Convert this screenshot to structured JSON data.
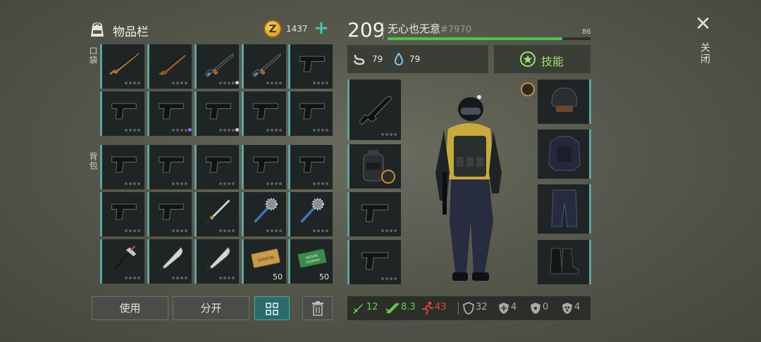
{
  "inventory": {
    "title": "物品栏",
    "coins": "1437",
    "coin_symbol": "Z",
    "add_symbol": "+",
    "pocket_label": "口袋",
    "backpack_label": "背包",
    "pocket_items": [
      {
        "icon": "sniper-rifle-icon",
        "marker": ""
      },
      {
        "icon": "shotgun-icon",
        "marker": ""
      },
      {
        "icon": "ak-rifle-icon",
        "marker": "#cfcfcf"
      },
      {
        "icon": "ak-rifle-icon",
        "marker": ""
      },
      {
        "icon": "pistol-icon",
        "marker": ""
      },
      {
        "icon": "pistol-icon",
        "marker": ""
      },
      {
        "icon": "pistol-icon",
        "marker": "#9a6bff"
      },
      {
        "icon": "pistol-icon",
        "marker": "#cfcfcf"
      },
      {
        "icon": "pistol-icon",
        "marker": ""
      },
      {
        "icon": "pistol-icon",
        "marker": ""
      },
      {
        "icon": "pistol-icon",
        "marker": ""
      }
    ],
    "backpack_items": [
      {
        "icon": "pistol-icon"
      },
      {
        "icon": "pistol-icon"
      },
      {
        "icon": "pistol-icon"
      },
      {
        "icon": "pistol-icon"
      },
      {
        "icon": "pistol-icon"
      },
      {
        "icon": "pistol-icon"
      },
      {
        "icon": "pistol-icon"
      },
      {
        "icon": "katana-icon"
      },
      {
        "icon": "spiked-mace-icon"
      },
      {
        "icon": "spiked-mace-icon"
      },
      {
        "icon": "hammer-icon"
      },
      {
        "icon": "machete-icon"
      },
      {
        "icon": "machete-icon"
      },
      {
        "icon": "supply-coupon-icon",
        "qty": "50"
      },
      {
        "icon": "ration-coupon-icon",
        "qty": "50"
      }
    ]
  },
  "buttons": {
    "use": "使用",
    "split": "分开"
  },
  "player": {
    "level": "209",
    "name": "无心也无意",
    "id": "#7970",
    "xp_value": "86",
    "xp_fraction": 0.86,
    "food": "79",
    "water": "79",
    "skills_label": "技能"
  },
  "stats": {
    "melee": "12",
    "ranged": "8.3",
    "speed": "43",
    "armor": "32",
    "cold": "4",
    "radiation": "0",
    "toxic": "4"
  },
  "close_label": "关闭",
  "colors": {
    "accent": "#5fa3a0",
    "xp": "#47c74a",
    "melee": "#5fd14a",
    "speed": "#e0463a",
    "skills": "#9ee070"
  }
}
